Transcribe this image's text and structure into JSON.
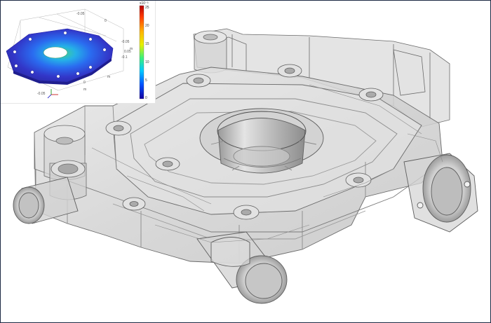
{
  "colorbar": {
    "exponent": "x10⁻³",
    "ticks": [
      "25",
      "20",
      "15",
      "10",
      "5",
      "0"
    ],
    "colors": [
      "#b40000",
      "#ff3a00",
      "#ffb400",
      "#e6f000",
      "#3cf07a",
      "#00c8ff",
      "#0050ff",
      "#14009e"
    ]
  },
  "inset_axes": {
    "tick_top_left": "-0.05",
    "tick_top_right": "0",
    "tick_right_upper": "-0.05",
    "tick_right_middle": "0.05",
    "tick_right_unit": "m",
    "tick_bottom_right": "0",
    "tick_bottom_unit": "m",
    "tick_bottom_left": "-0.05",
    "tick_left_unit": "m",
    "axis_value_right": "-0.1"
  },
  "colors": {
    "frame": "#1d2a44",
    "part_fill": "#dcdcdc",
    "edge": "#6e6e6e",
    "plate_base": "#3236c8"
  }
}
